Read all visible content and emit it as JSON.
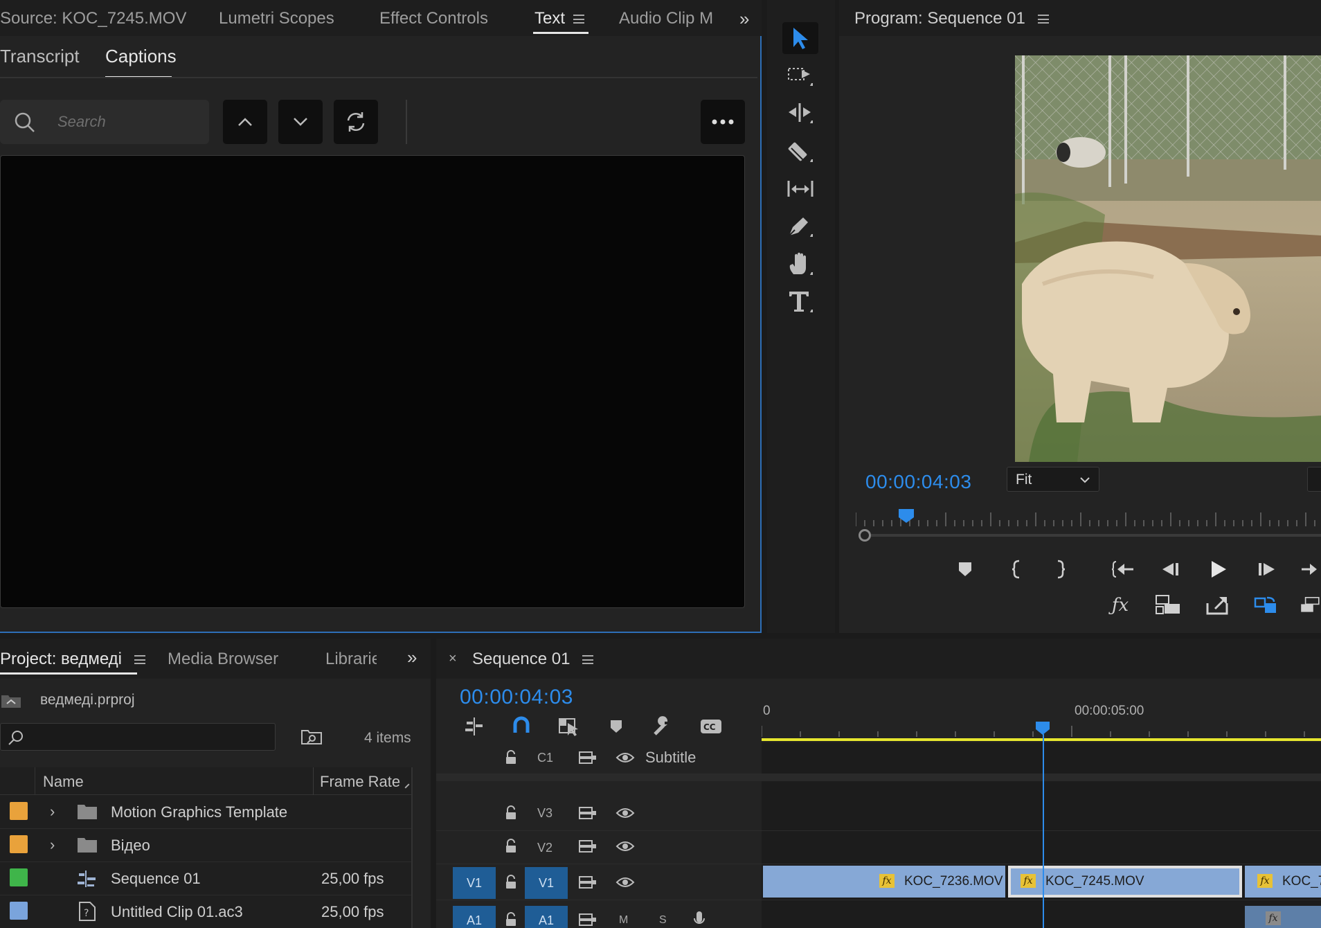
{
  "source_panel": {
    "tabs": [
      "Source: KOC_7245.MOV",
      "Lumetri Scopes",
      "Effect Controls",
      "Text",
      "Audio Clip M"
    ],
    "active_tab": "Text",
    "subtabs": [
      "Transcript",
      "Captions"
    ],
    "active_subtab": "Captions",
    "search_placeholder": "Search"
  },
  "program_panel": {
    "title": "Program: Sequence 01",
    "timecode": "00:00:04:03",
    "zoom": "Fit",
    "playhead_fraction": 0.107
  },
  "project_panel": {
    "tabs": [
      "Project: ведмеді",
      "Media Browser",
      "Librarie"
    ],
    "project_file": "ведмеді.prproj",
    "item_count": "4 items",
    "columns": [
      "Name",
      "Frame Rate"
    ],
    "items": [
      {
        "name": "Motion Graphics Template",
        "frame_rate": "",
        "color": "#e9a23b",
        "type": "folder"
      },
      {
        "name": "Відео",
        "frame_rate": "",
        "color": "#e9a23b",
        "type": "folder"
      },
      {
        "name": "Sequence 01",
        "frame_rate": "25,00 fps",
        "color": "#3fb54a",
        "type": "sequence"
      },
      {
        "name": "Untitled Clip 01.ac3",
        "frame_rate": "25,00 fps",
        "color": "#7aa4dc",
        "type": "audio"
      }
    ]
  },
  "timeline": {
    "title": "Sequence 01",
    "timecode": "00:00:04:03",
    "ruler_start": "0",
    "ruler_mark": "00:00:05:00",
    "tracks": [
      {
        "source": "",
        "target": "C1",
        "label": "Subtitle"
      },
      {
        "source": "",
        "target": "V3",
        "label": ""
      },
      {
        "source": "",
        "target": "V2",
        "label": ""
      },
      {
        "source": "V1",
        "target": "V1",
        "label": ""
      },
      {
        "source": "A1",
        "target": "A1",
        "label": "",
        "m": "M",
        "s": "S"
      }
    ],
    "clips": [
      "KOC_7236.MOV",
      "KOC_7245.MOV",
      "KOC_7"
    ],
    "fx_label": "fx"
  },
  "colors": {
    "accent": "#2d8ceb",
    "timecode": "#2d8ceb",
    "clip": "#86a8d6",
    "fx": "#e8c236",
    "work_area": "#e6e62e"
  }
}
